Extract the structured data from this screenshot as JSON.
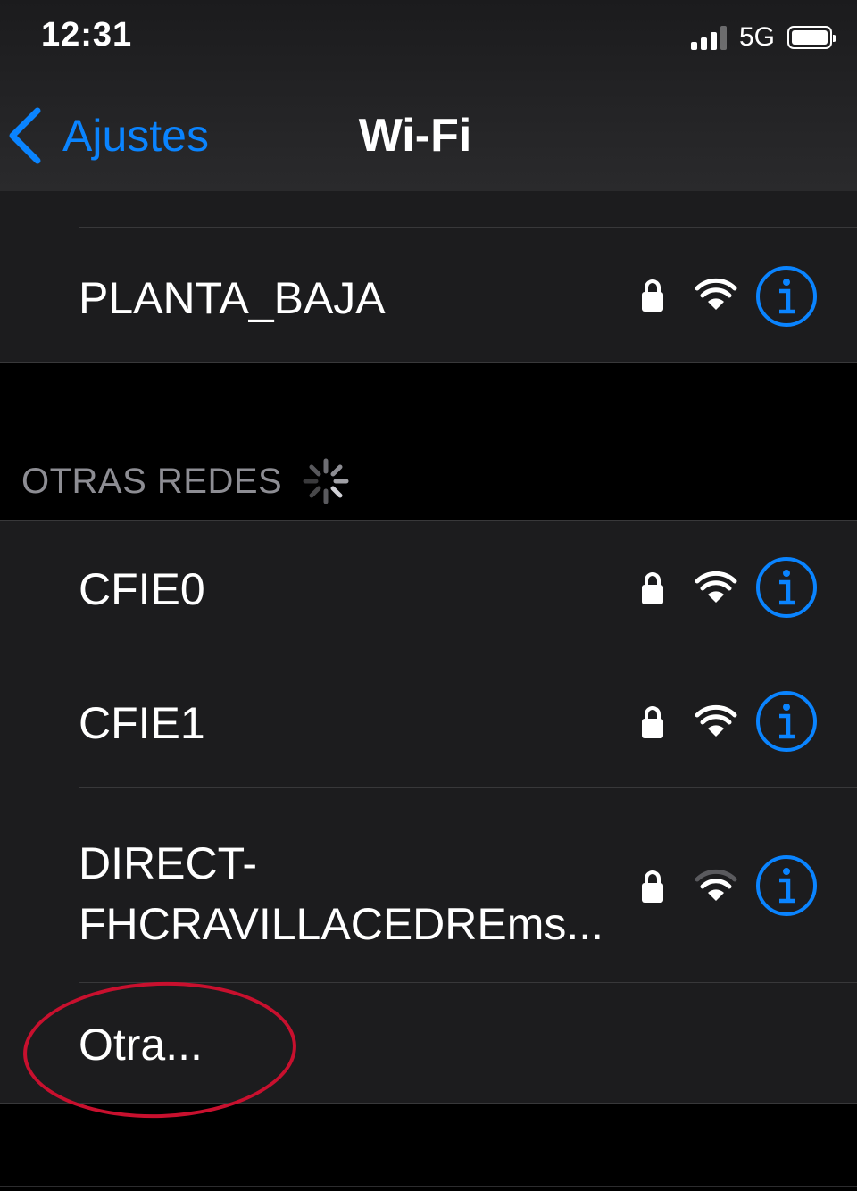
{
  "status_bar": {
    "time": "12:31",
    "network": "5G"
  },
  "nav": {
    "back_label": "Ajustes",
    "title": "Wi-Fi"
  },
  "my_networks": [
    {
      "name": "PLANTA_BAJA",
      "secured": true,
      "signal": "strong"
    }
  ],
  "other_networks": {
    "header": "OTRAS REDES",
    "items": [
      {
        "name": "CFIE0",
        "secured": true,
        "signal": "strong"
      },
      {
        "name": "CFIE1",
        "secured": true,
        "signal": "strong"
      },
      {
        "name_line1": "DIRECT-",
        "name_line2": "FHCRAVILLACEDREms...",
        "secured": true,
        "signal": "medium"
      }
    ],
    "other_label": "Otra..."
  },
  "colors": {
    "accent": "#0a84ff",
    "annotation": "#c8102e",
    "cell_bg": "#1c1c1e"
  },
  "icons": [
    "chevron-left-icon",
    "lock-icon",
    "wifi-icon",
    "info-icon",
    "spinner-icon"
  ]
}
